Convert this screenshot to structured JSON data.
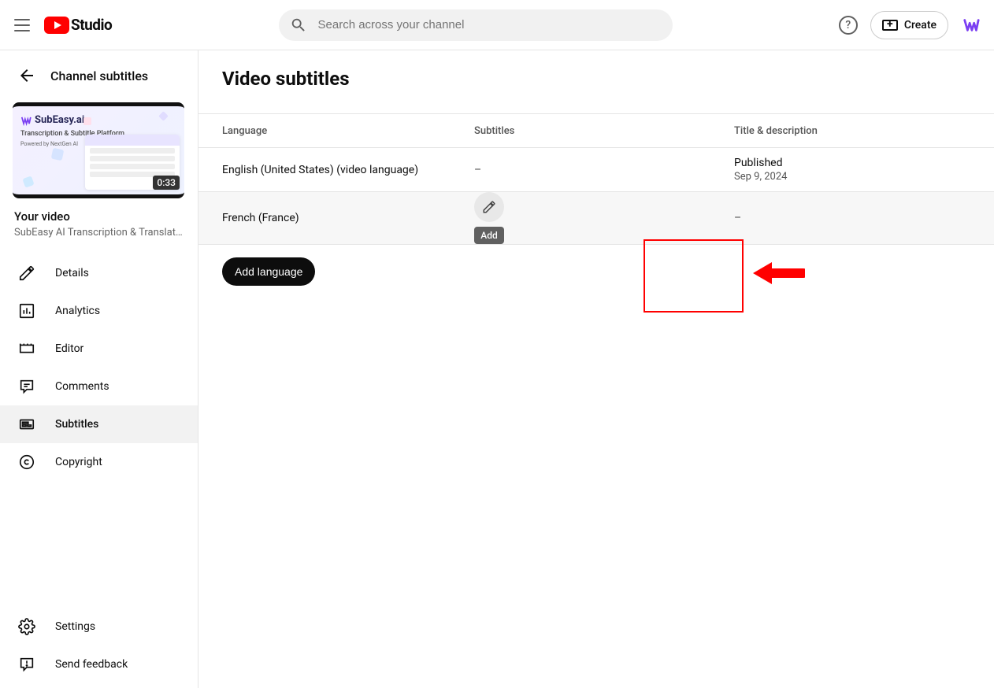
{
  "header": {
    "logo_text": "Studio",
    "search_placeholder": "Search across your channel",
    "create_label": "Create"
  },
  "sidebar": {
    "back_title": "Channel subtitles",
    "thumb_duration": "0:33",
    "thumb_brand": "SubEasy.ai",
    "thumb_line1": "Transcription & Subtitle Platform",
    "thumb_line2": "Powered by NextGen AI",
    "your_video_label": "Your video",
    "video_title": "SubEasy AI Transcription & Translati…",
    "items": [
      {
        "label": "Details"
      },
      {
        "label": "Analytics"
      },
      {
        "label": "Editor"
      },
      {
        "label": "Comments"
      },
      {
        "label": "Subtitles"
      },
      {
        "label": "Copyright"
      }
    ],
    "footer": {
      "settings": "Settings",
      "feedback": "Send feedback"
    }
  },
  "main": {
    "page_title": "Video subtitles",
    "columns": {
      "language": "Language",
      "subtitles": "Subtitles",
      "titledesc": "Title & description"
    },
    "rows": [
      {
        "language": "English (United States) (video language)",
        "subtitles": "–",
        "title_status": "Published",
        "title_date": "Sep 9, 2024"
      },
      {
        "language": "French (France)",
        "subtitles_tooltip": "Add",
        "title_status": "–"
      }
    ],
    "add_language_label": "Add language"
  }
}
